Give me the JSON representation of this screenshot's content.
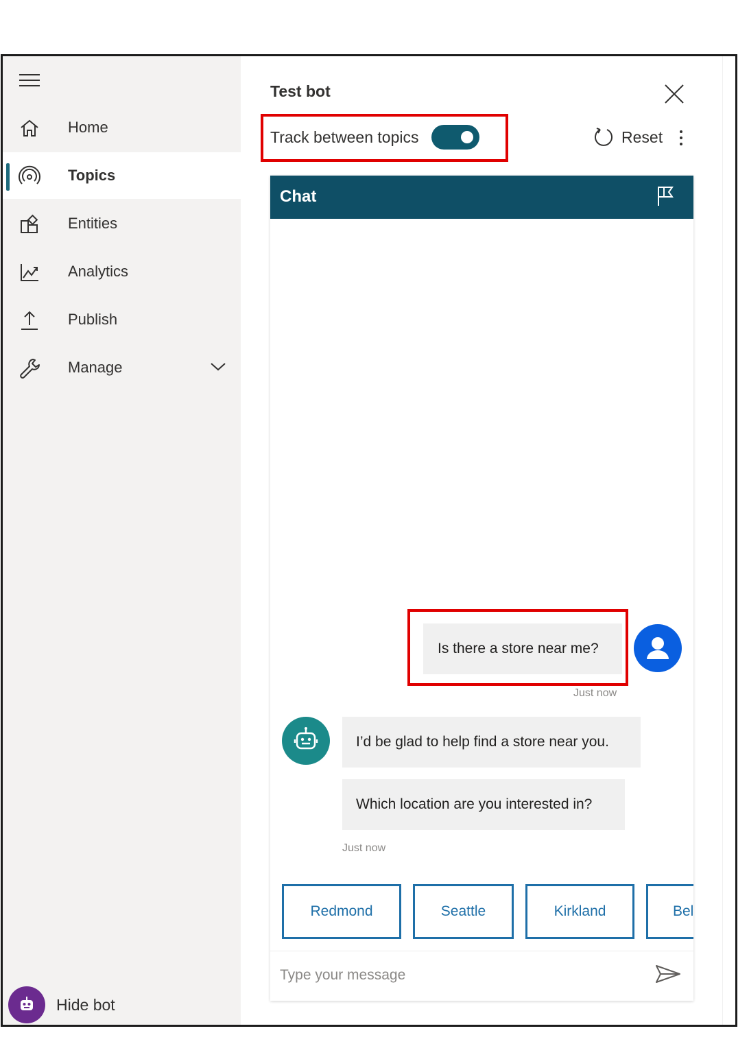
{
  "sidebar": {
    "items": [
      {
        "label": "Home",
        "icon": "home-icon"
      },
      {
        "label": "Topics",
        "icon": "topics-icon",
        "selected": true
      },
      {
        "label": "Entities",
        "icon": "entities-icon"
      },
      {
        "label": "Analytics",
        "icon": "analytics-icon"
      },
      {
        "label": "Publish",
        "icon": "publish-icon"
      },
      {
        "label": "Manage",
        "icon": "wrench-icon"
      }
    ],
    "hide_bot_label": "Hide bot"
  },
  "panel": {
    "title": "Test bot",
    "track_label": "Track between topics",
    "track_enabled": true,
    "reset_label": "Reset"
  },
  "chat": {
    "header": "Chat",
    "messages": [
      {
        "from": "user",
        "text": "Is there a store near me?",
        "timestamp": "Just now"
      },
      {
        "from": "bot",
        "text": "I’d be glad to help find a store near you."
      },
      {
        "from": "bot",
        "text": "Which location are you interested in?",
        "timestamp": "Just now"
      }
    ],
    "suggestions": [
      "Redmond",
      "Seattle",
      "Kirkland",
      "Bel"
    ],
    "input_placeholder": "Type your message"
  },
  "colors": {
    "sidebar_bg": "#f3f2f1",
    "chat_header_bg": "#0f4f66",
    "highlight": "#e00000",
    "suggestion_accent": "#1e6fa8",
    "user_avatar": "#0a5fe0",
    "bot_avatar": "#1b8a8a",
    "hide_bot_avatar": "#6b2b8f"
  }
}
